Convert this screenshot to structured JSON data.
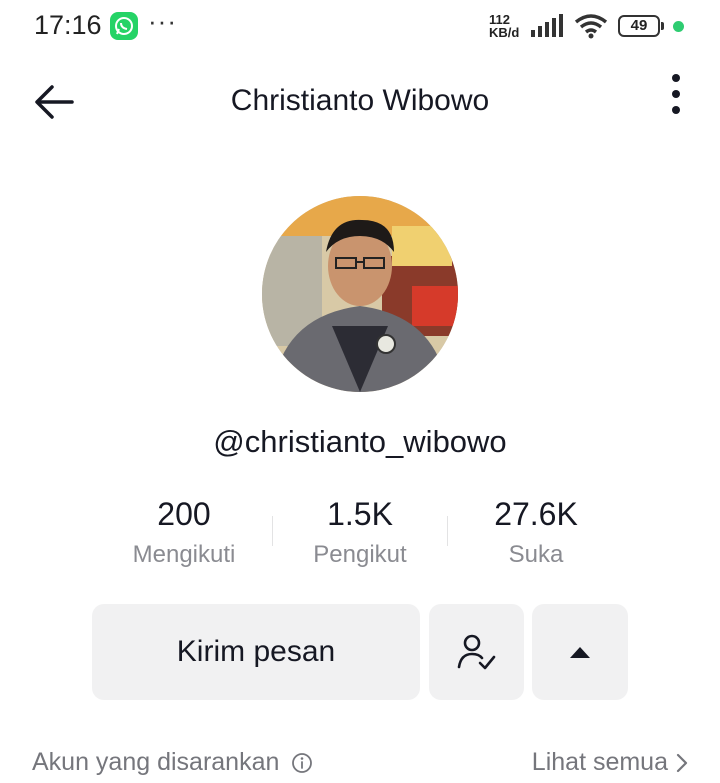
{
  "status_bar": {
    "time": "17:16",
    "more": "···",
    "net_speed_value": "112",
    "net_speed_unit": "KB/d",
    "battery": "49",
    "icons": [
      "whatsapp-icon",
      "signal-icon",
      "wifi-icon",
      "battery-icon"
    ]
  },
  "header": {
    "title": "Christianto Wibowo",
    "back_icon": "arrow-left-icon",
    "menu_icon": "vertical-dots-icon"
  },
  "profile": {
    "username": "@christianto_wibowo",
    "stats": [
      {
        "value": "200",
        "label": "Mengikuti"
      },
      {
        "value": "1.5K",
        "label": "Pengikut"
      },
      {
        "value": "27.6K",
        "label": "Suka"
      }
    ]
  },
  "actions": {
    "message_label": "Kirim pesan",
    "follow_icon": "user-check-icon",
    "more_icon": "triangle-up-icon"
  },
  "suggestions": {
    "label": "Akun yang disarankan",
    "see_all": "Lihat semua"
  },
  "colors": {
    "text_primary": "#161823",
    "text_secondary": "#8a8b91",
    "button_bg": "#f1f1f2",
    "status_green": "#2ecc71"
  }
}
